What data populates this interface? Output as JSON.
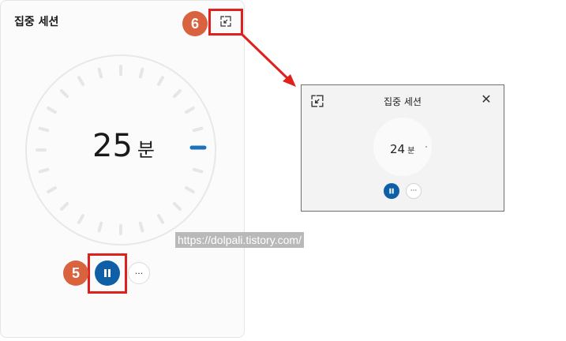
{
  "card": {
    "title": "집중 세션",
    "timer_value": "25",
    "timer_unit": "분",
    "more_label": "···"
  },
  "icons": {
    "expand": "compact-mode-icon",
    "pause": "pause-icon",
    "close": "close-icon"
  },
  "callouts": [
    {
      "label": "6"
    },
    {
      "label": "5"
    }
  ],
  "watermark": "https://dolpali.tistory.com/",
  "mini_window": {
    "title": "집중 세션",
    "timer_value": "24",
    "timer_unit": "분",
    "close_label": "✕",
    "more_label": "···"
  },
  "colors": {
    "accent": "#0f5fa6",
    "callout": "#e0201c",
    "badge": "#d9623f"
  }
}
